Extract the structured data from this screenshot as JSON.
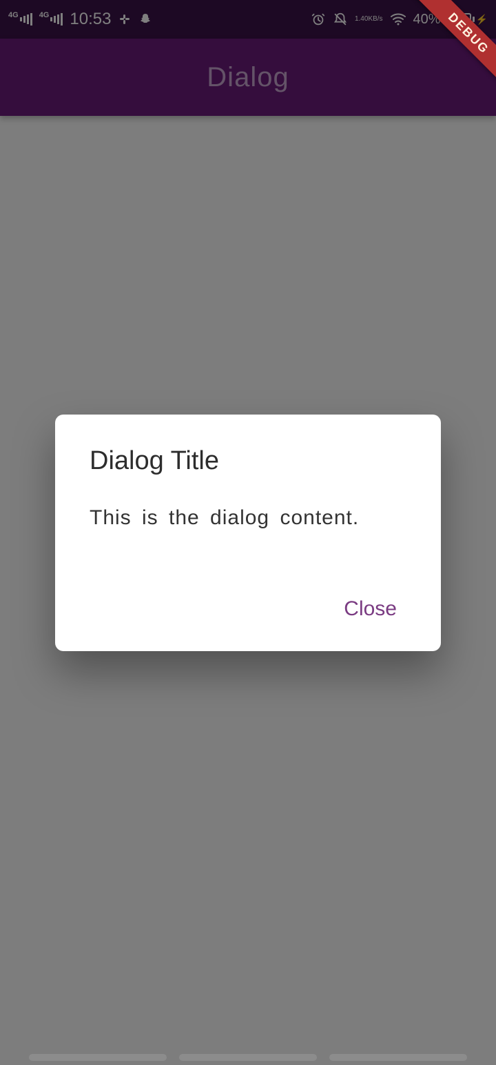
{
  "status": {
    "sig1_label": "4G",
    "sig2_label": "4G",
    "time": "10:53",
    "net_speed_top": "1.40",
    "net_speed_bottom": "KB/s",
    "battery_pct": "40%"
  },
  "appbar": {
    "title": "Dialog"
  },
  "dialog": {
    "title": "Dialog Title",
    "content": "This is the dialog content.",
    "close_label": "Close"
  },
  "debug_banner": "DEBUG"
}
